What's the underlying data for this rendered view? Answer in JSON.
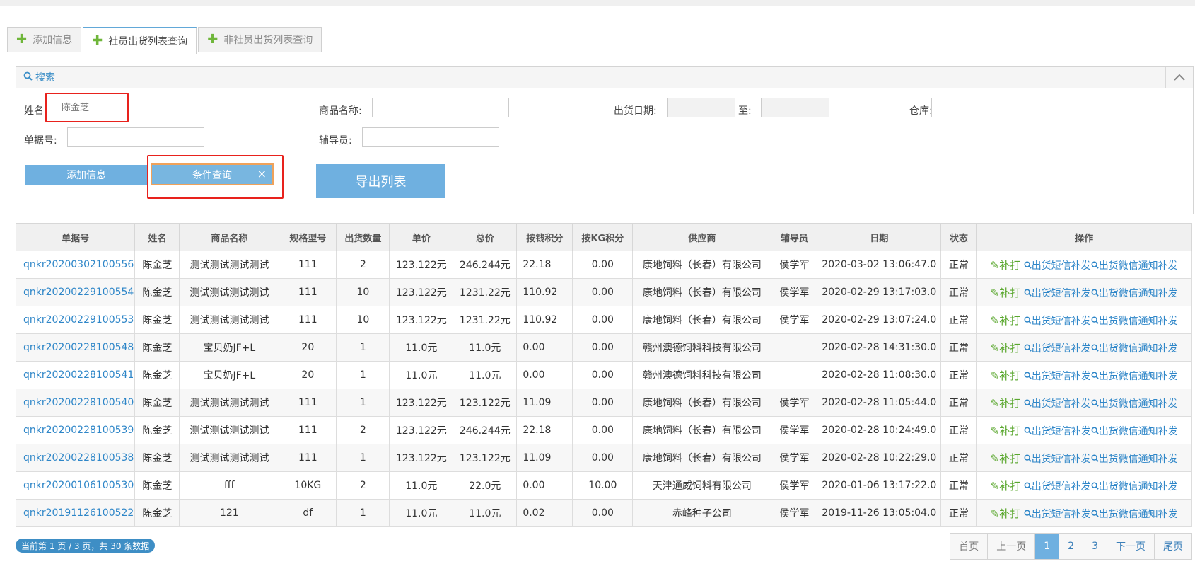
{
  "tabs": [
    {
      "label": "添加信息"
    },
    {
      "label": "社员出货列表查询"
    },
    {
      "label": "非社员出货列表查询"
    }
  ],
  "search": {
    "title": "搜索",
    "name_label": "姓名",
    "name_value": "陈金芝",
    "product_label": "商品名称:",
    "date_label": "出货日期:",
    "to_label": "至:",
    "warehouse_label": "仓库:",
    "bill_label": "单据号:",
    "advisor_label": "辅导员:",
    "add_button": "添加信息",
    "query_button": "条件查询",
    "close_glyph": "×",
    "export_button": "导出列表"
  },
  "table": {
    "headers": [
      "单据号",
      "姓名",
      "商品名称",
      "规格型号",
      "出货数量",
      "单价",
      "总价",
      "按钱积分",
      "按KG积分",
      "供应商",
      "辅导员",
      "日期",
      "状态",
      "操作"
    ],
    "rows": [
      [
        "qnkr20200302100556",
        "陈金芝",
        "测试测试测试测试",
        "111",
        "2",
        "123.122元",
        "246.244元",
        "22.18",
        "0.00",
        "康地饲料（长春）有限公司",
        "侯学军",
        "2020-03-02 13:06:47.0",
        "正常"
      ],
      [
        "qnkr20200229100554",
        "陈金芝",
        "测试测试测试测试",
        "111",
        "10",
        "123.122元",
        "1231.22元",
        "110.92",
        "0.00",
        "康地饲料（长春）有限公司",
        "侯学军",
        "2020-02-29 13:17:03.0",
        "正常"
      ],
      [
        "qnkr20200229100553",
        "陈金芝",
        "测试测试测试测试",
        "111",
        "10",
        "123.122元",
        "1231.22元",
        "110.92",
        "0.00",
        "康地饲料（长春）有限公司",
        "侯学军",
        "2020-02-29 13:07:24.0",
        "正常"
      ],
      [
        "qnkr20200228100548",
        "陈金芝",
        "宝贝奶JF+L",
        "20",
        "1",
        "11.0元",
        "11.0元",
        "0.00",
        "0.00",
        "赣州澳德饲料科技有限公司",
        "",
        "2020-02-28 14:31:30.0",
        "正常"
      ],
      [
        "qnkr20200228100541",
        "陈金芝",
        "宝贝奶JF+L",
        "20",
        "1",
        "11.0元",
        "11.0元",
        "0.00",
        "0.00",
        "赣州澳德饲料科技有限公司",
        "",
        "2020-02-28 11:08:30.0",
        "正常"
      ],
      [
        "qnkr20200228100540",
        "陈金芝",
        "测试测试测试测试",
        "111",
        "1",
        "123.122元",
        "123.122元",
        "11.09",
        "0.00",
        "康地饲料（长春）有限公司",
        "侯学军",
        "2020-02-28 11:05:44.0",
        "正常"
      ],
      [
        "qnkr20200228100539",
        "陈金芝",
        "测试测试测试测试",
        "111",
        "2",
        "123.122元",
        "246.244元",
        "22.18",
        "0.00",
        "康地饲料（长春）有限公司",
        "侯学军",
        "2020-02-28 10:24:49.0",
        "正常"
      ],
      [
        "qnkr20200228100538",
        "陈金芝",
        "测试测试测试测试",
        "111",
        "1",
        "123.122元",
        "123.122元",
        "11.09",
        "0.00",
        "康地饲料（长春）有限公司",
        "侯学军",
        "2020-02-28 10:22:29.0",
        "正常"
      ],
      [
        "qnkr20200106100530",
        "陈金芝",
        "fff",
        "10KG",
        "2",
        "11.0元",
        "22.0元",
        "0.00",
        "10.00",
        "天津通威饲料有限公司",
        "侯学军",
        "2020-01-06 13:17:22.0",
        "正常"
      ],
      [
        "qnkr20191126100522",
        "陈金芝",
        "121",
        "df",
        "1",
        "11.0元",
        "11.0元",
        "0.02",
        "0.00",
        "赤峰种子公司",
        "侯学军",
        "2019-11-26 13:05:04.0",
        "正常"
      ]
    ],
    "ops": {
      "patch": "补打",
      "sms": "出货短信补发",
      "wechat": "出货微信通知补发"
    }
  },
  "footer": {
    "page_info": "当前第 1 页 / 3 页，共 30 条数据",
    "pager": [
      "首页",
      "上一页",
      "1",
      "2",
      "3",
      "下一页",
      "尾页"
    ]
  },
  "colors": {
    "accent": "#6fb0e0",
    "link": "#2e86c8",
    "patch_green": "#5aa72e",
    "highlight_red": "#e8221d"
  }
}
